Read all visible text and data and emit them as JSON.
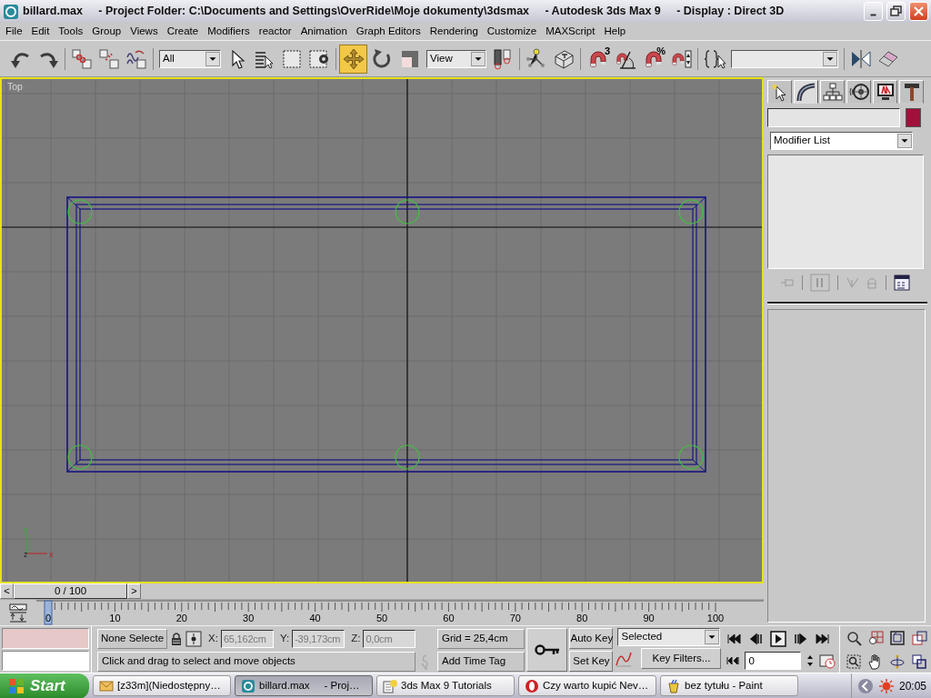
{
  "window": {
    "title": "billard.max     - Project Folder: C:\\Documents and Settings\\OverRide\\Moje dokumenty\\3dsmax     - Autodesk 3ds Max 9     - Display : Direct 3D"
  },
  "menu": [
    "File",
    "Edit",
    "Tools",
    "Group",
    "Views",
    "Create",
    "Modifiers",
    "reactor",
    "Animation",
    "Graph Editors",
    "Rendering",
    "Customize",
    "MAXScript",
    "Help"
  ],
  "toolbar": {
    "selection_filter": "All",
    "transform_tools": [
      {
        "kind": "move",
        "selected": true
      },
      {
        "kind": "rotate",
        "selected": false
      },
      {
        "kind": "scale",
        "selected": false
      }
    ],
    "coordinate_system": "View",
    "snap_labels": [
      "3",
      "%"
    ]
  },
  "viewport": {
    "label": "Top",
    "active": true,
    "axis_labels": [
      "y",
      "z",
      "x"
    ]
  },
  "command_panel": {
    "tabs": [
      {
        "kind": "create",
        "selected": false
      },
      {
        "kind": "modify",
        "selected": true
      },
      {
        "kind": "hierarchy",
        "selected": false
      },
      {
        "kind": "motion",
        "selected": false
      },
      {
        "kind": "display",
        "selected": false
      },
      {
        "kind": "utilities",
        "selected": false
      }
    ],
    "color_swatch": {
      "color": "#a0103a"
    },
    "modifier_list": "Modifier List"
  },
  "time_slider": {
    "prev": "<",
    "label": "0 / 100",
    "next": ">",
    "level": 0
  },
  "track_bar": {
    "frame_labels": [
      "0",
      "10",
      "20",
      "30",
      "40",
      "50",
      "60",
      "70",
      "80",
      "90",
      "100"
    ]
  },
  "status": {
    "selection": "None Selecte",
    "x_label": "X:",
    "x": "65,162cm",
    "y_label": "Y:",
    "y": "-39,173cm",
    "z_label": "Z:",
    "z": "0,0cm",
    "grid": "Grid = 25,4cm",
    "prompt": "Click and drag to select and move objects",
    "add_time_tag": "Add Time Tag"
  },
  "animation": {
    "auto_key": "Auto Key",
    "set_key": "Set Key",
    "key_mode": "Selected",
    "key_filters": "Key Filters...",
    "current_frame": "0"
  },
  "taskbar": {
    "start": "Start",
    "tasks": [
      {
        "kind": "mail",
        "label": "[z33m](Niedostępny…",
        "selected": false
      },
      {
        "kind": "max",
        "label": "billard.max     - Proj…",
        "selected": true
      },
      {
        "kind": "help",
        "label": "3ds Max 9 Tutorials",
        "selected": false
      },
      {
        "kind": "browser",
        "label": "Czy warto kupić Nev…",
        "selected": false
      },
      {
        "kind": "paint",
        "label": "bez tytułu - Paint",
        "selected": false
      }
    ],
    "clock": "20:05"
  }
}
